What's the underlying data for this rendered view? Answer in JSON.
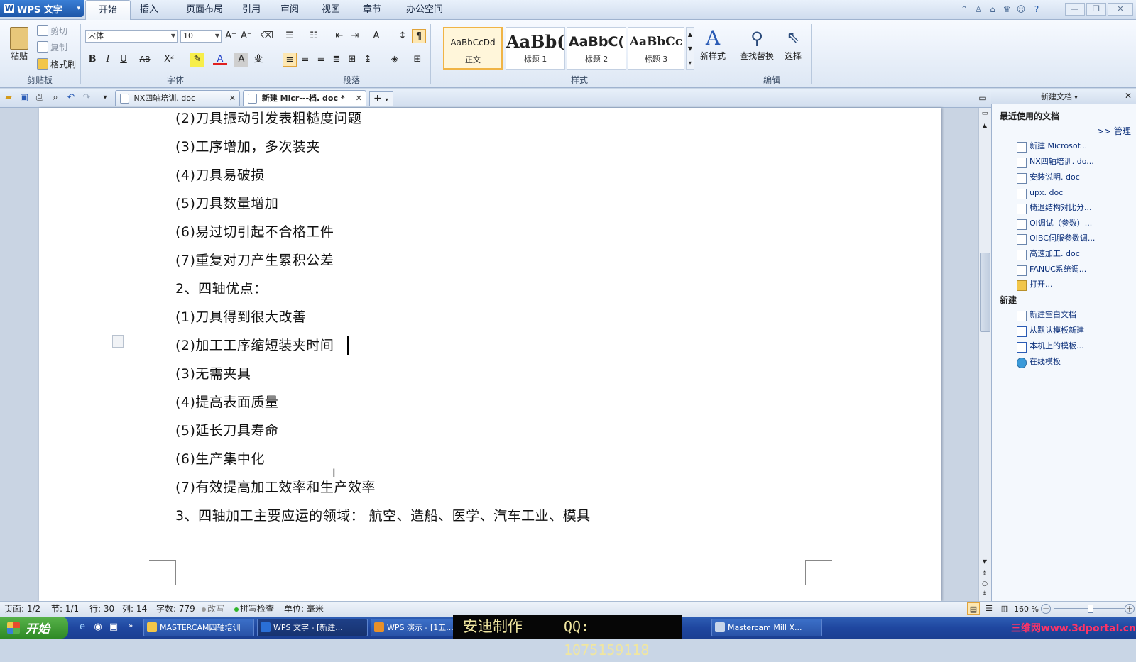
{
  "app": {
    "title": "WPS 文字"
  },
  "menu_tabs": [
    "开始",
    "插入",
    "页面布局",
    "引用",
    "审阅",
    "视图",
    "章节",
    "办公空间"
  ],
  "ribbon": {
    "clipboard": {
      "paste": "粘贴",
      "cut": "剪切",
      "copy": "复制",
      "format_painter": "格式刷",
      "label": "剪贴板"
    },
    "font": {
      "name": "宋体",
      "size": "10",
      "label": "字体"
    },
    "paragraph": {
      "label": "段落"
    },
    "styles": {
      "items": [
        {
          "preview": "AaBbCcDd",
          "name": "正文"
        },
        {
          "preview": "AaBb(",
          "name": "标题 1"
        },
        {
          "preview": "AaBbC(",
          "name": "标题 2"
        },
        {
          "preview": "AaBbCc",
          "name": "标题 3"
        }
      ],
      "new_style": "新样式",
      "label": "样式"
    },
    "edit": {
      "find_replace": "查找替换",
      "select": "选择",
      "label": "编辑"
    }
  },
  "doc_tabs": [
    {
      "name": "NX四轴培训. doc",
      "active": false
    },
    {
      "name": "新建 Micr---档. doc *",
      "active": true
    }
  ],
  "document": {
    "lines": [
      "(2)刀具振动引发表粗糙度问题",
      "(3)工序增加，多次装夹",
      "(4)刀具易破损",
      "(5)刀具数量增加",
      "(6)易过切引起不合格工件",
      "(7)重复对刀产生累积公差",
      "2、四轴优点：",
      "(1)刀具得到很大改善",
      "(2)加工工序缩短装夹时间",
      "(3)无需夹具",
      "(4)提高表面质量",
      "(5)延长刀具寿命",
      "(6)生产集中化",
      "(7)有效提高加工效率和生产效率",
      "3、四轴加工主要应运的领域：  航空、造船、医学、汽车工业、模具"
    ]
  },
  "task_pane": {
    "title": "新建文档",
    "recent_heading": "最近使用的文档",
    "manage": ">> 管理",
    "recent": [
      "新建 Microsof...",
      "NX四轴培训. do...",
      "安装说明. doc",
      "upx. doc",
      "椅退结构对比分...",
      "Oi调试（参数）...",
      "OIBC伺服参数调...",
      "高速加工. doc",
      "FANUC系统调...",
      "打开..."
    ],
    "new_heading": "新建",
    "new_items": [
      "新建空白文档",
      "从默认模板新建",
      "本机上的模板...",
      "在线模板"
    ]
  },
  "status": {
    "page": "页面: 1/2",
    "section": "节: 1/1",
    "row": "行: 30",
    "col": "列: 14",
    "words": "字数: 779",
    "overwrite": "改写",
    "spell": "拼写检查",
    "unit": "单位: 毫米",
    "zoom": "160 %"
  },
  "taskbar": {
    "start": "开始",
    "tasks": [
      "MASTERCAM四轴培训",
      "WPS 文字 - [新建...",
      "WPS 演示 - [1五...",
      "Mastercam Mill X..."
    ],
    "overlay_left": "安迪制作",
    "overlay_right": "QQ: 1075159118",
    "watermark": "三维网www.3dportal.cn"
  }
}
